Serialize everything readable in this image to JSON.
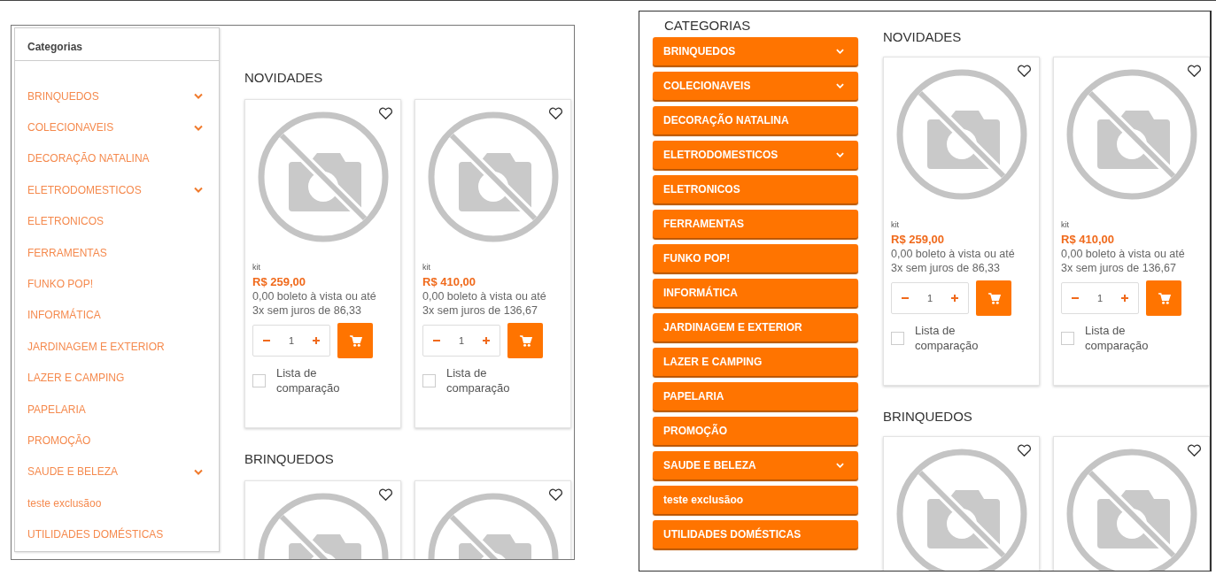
{
  "panels": [
    {
      "kind": "plain",
      "categories_title": "Categorias",
      "categories": [
        {
          "label": "BRINQUEDOS",
          "has_submenu": true
        },
        {
          "label": "COLECIONAVEIS",
          "has_submenu": true
        },
        {
          "label": "DECORAÇÃO NATALINA",
          "has_submenu": false
        },
        {
          "label": "ELETRODOMESTICOS",
          "has_submenu": true
        },
        {
          "label": "ELETRONICOS",
          "has_submenu": false
        },
        {
          "label": "FERRAMENTAS",
          "has_submenu": false
        },
        {
          "label": "FUNKO POP!",
          "has_submenu": false
        },
        {
          "label": "INFORMÁTICA",
          "has_submenu": false
        },
        {
          "label": "JARDINAGEM E EXTERIOR",
          "has_submenu": false
        },
        {
          "label": "LAZER E CAMPING",
          "has_submenu": false
        },
        {
          "label": "PAPELARIA",
          "has_submenu": false
        },
        {
          "label": "PROMOÇÃO",
          "has_submenu": false
        },
        {
          "label": "SAUDE E BELEZA",
          "has_submenu": true
        },
        {
          "label": "teste exclusãoo",
          "has_submenu": false
        },
        {
          "label": "UTILIDADES DOMÉSTICAS",
          "has_submenu": false
        }
      ],
      "sections": [
        {
          "title": "NOVIDADES",
          "products": [
            {
              "favorite": false,
              "name": "kit",
              "price": "R$ 259,00",
              "installments": "0,00 boleto à vista ou até 3x sem juros de 86,33",
              "quantity": "1",
              "compare_label": "Lista de comparação",
              "compare_checked": false
            },
            {
              "favorite": false,
              "name": "kit",
              "price": "R$ 410,00",
              "installments": "0,00 boleto à vista ou até 3x sem juros de 136,67",
              "quantity": "1",
              "compare_label": "Lista de comparação",
              "compare_checked": false
            }
          ]
        },
        {
          "title": "BRINQUEDOS",
          "products": [
            {
              "favorite": false
            },
            {
              "favorite": false
            }
          ]
        }
      ]
    },
    {
      "kind": "filled",
      "categories_title": "CATEGORIAS",
      "categories": [
        {
          "label": "BRINQUEDOS",
          "has_submenu": true
        },
        {
          "label": "COLECIONAVEIS",
          "has_submenu": true
        },
        {
          "label": "DECORAÇÃO NATALINA",
          "has_submenu": false
        },
        {
          "label": "ELETRODOMESTICOS",
          "has_submenu": true
        },
        {
          "label": "ELETRONICOS",
          "has_submenu": false
        },
        {
          "label": "FERRAMENTAS",
          "has_submenu": false
        },
        {
          "label": "FUNKO POP!",
          "has_submenu": false
        },
        {
          "label": "INFORMÁTICA",
          "has_submenu": false
        },
        {
          "label": "JARDINAGEM E EXTERIOR",
          "has_submenu": false
        },
        {
          "label": "LAZER E CAMPING",
          "has_submenu": false
        },
        {
          "label": "PAPELARIA",
          "has_submenu": false
        },
        {
          "label": "PROMOÇÃO",
          "has_submenu": false
        },
        {
          "label": "SAUDE E BELEZA",
          "has_submenu": true
        },
        {
          "label": "teste exclusãoo",
          "has_submenu": false
        },
        {
          "label": "UTILIDADES DOMÉSTICAS",
          "has_submenu": false
        }
      ],
      "sections": [
        {
          "title": "NOVIDADES",
          "products": [
            {
              "favorite": false,
              "name": "kit",
              "price": "R$ 259,00",
              "installments": "0,00 boleto à vista ou até 3x sem juros de 86,33",
              "quantity": "1",
              "compare_label": "Lista de comparação",
              "compare_checked": false
            },
            {
              "favorite": false,
              "name": "kit",
              "price": "R$ 410,00",
              "installments": "0,00 boleto à vista ou até 3x sem juros de 136,67",
              "quantity": "1",
              "compare_label": "Lista de comparação",
              "compare_checked": false
            }
          ]
        },
        {
          "title": "BRINQUEDOS",
          "products": [
            {
              "favorite": false
            },
            {
              "favorite": false
            }
          ]
        }
      ]
    }
  ]
}
